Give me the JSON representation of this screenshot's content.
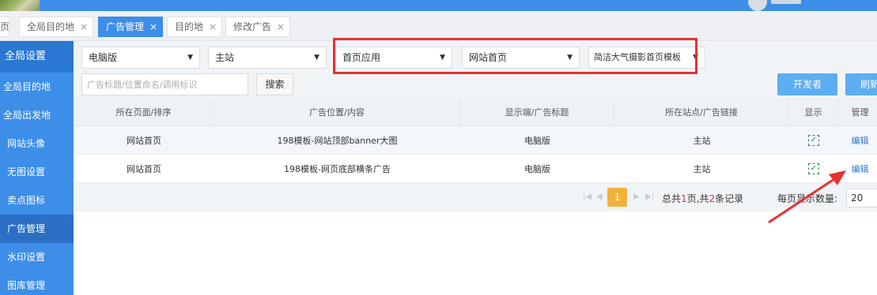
{
  "topbar": {
    "accent": "#3c8ee8"
  },
  "tabs": [
    {
      "label": "页",
      "closable": false
    },
    {
      "label": "全局目的地",
      "closable": true
    },
    {
      "label": "广告管理",
      "closable": true,
      "active": true
    },
    {
      "label": "目的地",
      "closable": true
    },
    {
      "label": "修改广告",
      "closable": true
    }
  ],
  "tab_close_glyph": "×",
  "sidebar": {
    "header": "全局设置",
    "items": [
      {
        "label": "全局目的地"
      },
      {
        "label": "全局出发地"
      },
      {
        "label": "网站头像"
      },
      {
        "label": "无图设置"
      },
      {
        "label": "卖点图标"
      },
      {
        "label": "广告管理",
        "active": true
      },
      {
        "label": "水印设置"
      },
      {
        "label": "图库管理"
      }
    ]
  },
  "filters": {
    "platform": "电脑版",
    "site": "主站",
    "app": "首页应用",
    "page": "网站首页",
    "template": "简洁大气摄影首页模板"
  },
  "search": {
    "placeholder": "广告标题/位置命名/调用标识",
    "button_label": "搜索"
  },
  "actions": {
    "developer_label": "开发者",
    "refresh_label": "刷新"
  },
  "table": {
    "headers": [
      "所在页面/排序",
      "广告位置/内容",
      "显示端/广告标题",
      "所在站点/广告链接",
      "显示",
      "管理"
    ],
    "rows": [
      {
        "page": "网站首页",
        "position": "198模板-网站顶部banner大图",
        "platform": "电脑版",
        "site": "主站",
        "display": "✓",
        "action": "编辑"
      },
      {
        "page": "网站首页",
        "position": "198模板-网页底部横条广告",
        "platform": "电脑版",
        "site": "主站",
        "display": "✓",
        "action": "编辑"
      }
    ]
  },
  "pager": {
    "current_page": "1",
    "summary_prefix": "总共",
    "total_pages": "1",
    "summary_mid": "页,共",
    "total_records": "2",
    "summary_suffix": "条记录",
    "per_page_label": "每页显示数量:",
    "per_page_value": "20"
  },
  "annotation": {
    "color": "#e53232"
  }
}
